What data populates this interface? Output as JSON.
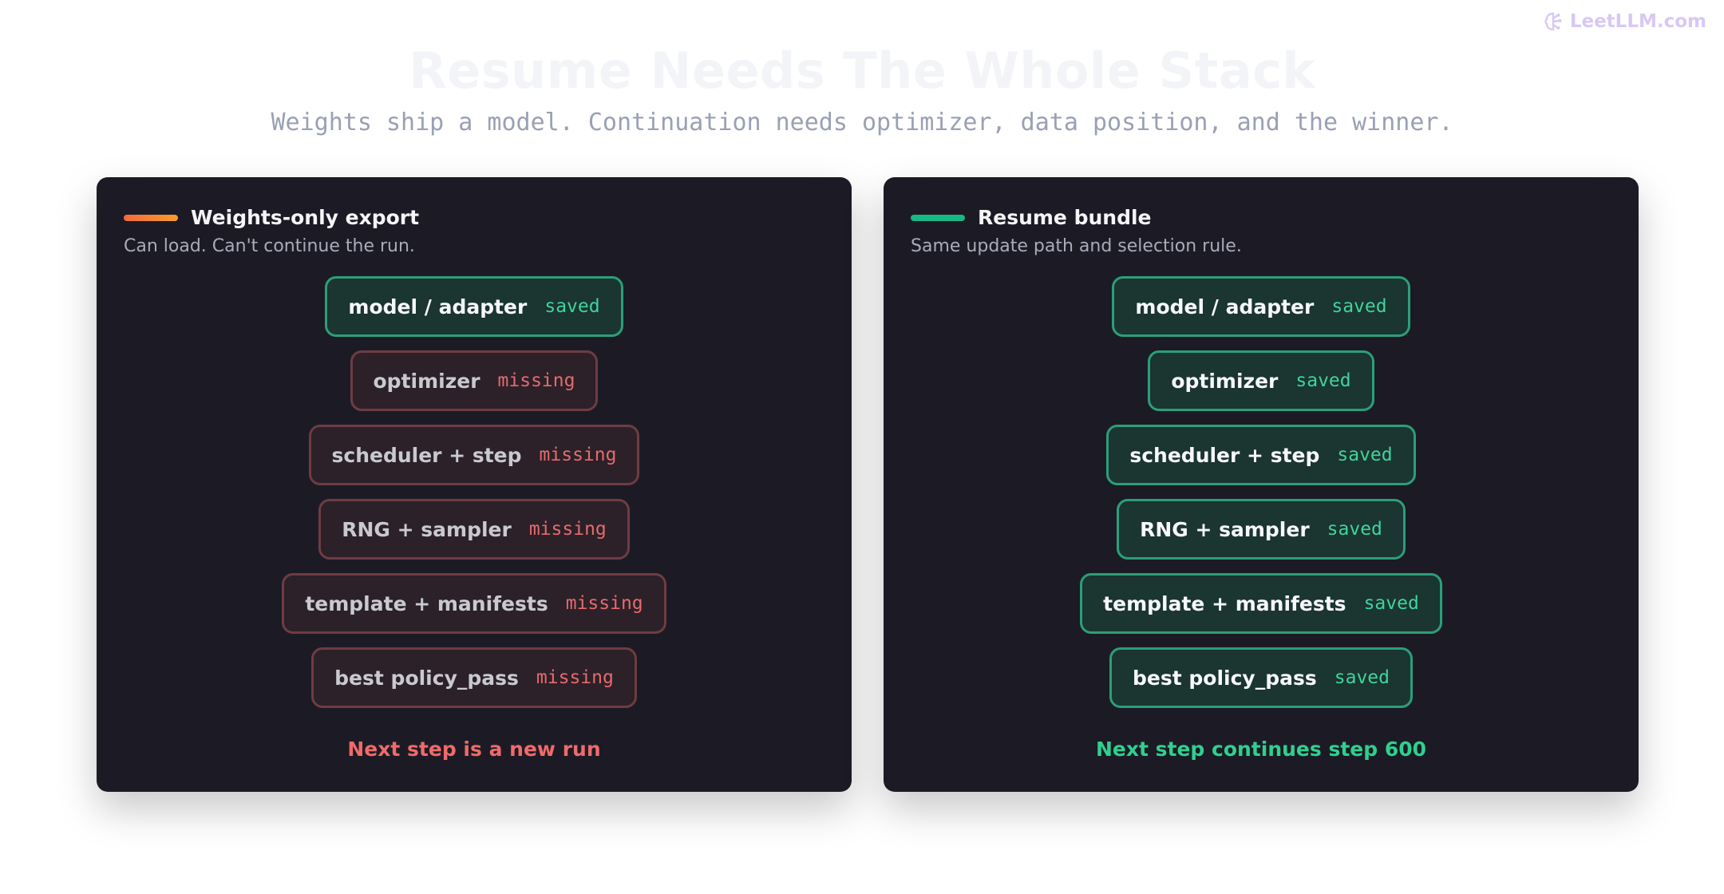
{
  "brand": {
    "name": "LeetLLM.com",
    "icon": "brain-icon"
  },
  "title": "Resume Needs The Whole Stack",
  "subtitle": "Weights ship a model. Continuation needs optimizer, data position, and the winner.",
  "colors": {
    "saved": "#3fd49c",
    "missing": "#e66a6f",
    "left_accent_start": "#f26a3d",
    "left_accent_end": "#f89b2e",
    "right_accent": "#17b885"
  },
  "panels": [
    {
      "title": "Weights-only export",
      "description": "Can load. Can't continue the run.",
      "outcome": "Next step is a new run",
      "items": [
        {
          "name": "model / adapter",
          "status": "saved"
        },
        {
          "name": "optimizer",
          "status": "missing"
        },
        {
          "name": "scheduler + step",
          "status": "missing"
        },
        {
          "name": "RNG + sampler",
          "status": "missing"
        },
        {
          "name": "template + manifests",
          "status": "missing"
        },
        {
          "name": "best policy_pass",
          "status": "missing"
        }
      ]
    },
    {
      "title": "Resume bundle",
      "description": "Same update path and selection rule.",
      "outcome": "Next step continues step 600",
      "items": [
        {
          "name": "model / adapter",
          "status": "saved"
        },
        {
          "name": "optimizer",
          "status": "saved"
        },
        {
          "name": "scheduler + step",
          "status": "saved"
        },
        {
          "name": "RNG + sampler",
          "status": "saved"
        },
        {
          "name": "template + manifests",
          "status": "saved"
        },
        {
          "name": "best policy_pass",
          "status": "saved"
        }
      ]
    }
  ]
}
